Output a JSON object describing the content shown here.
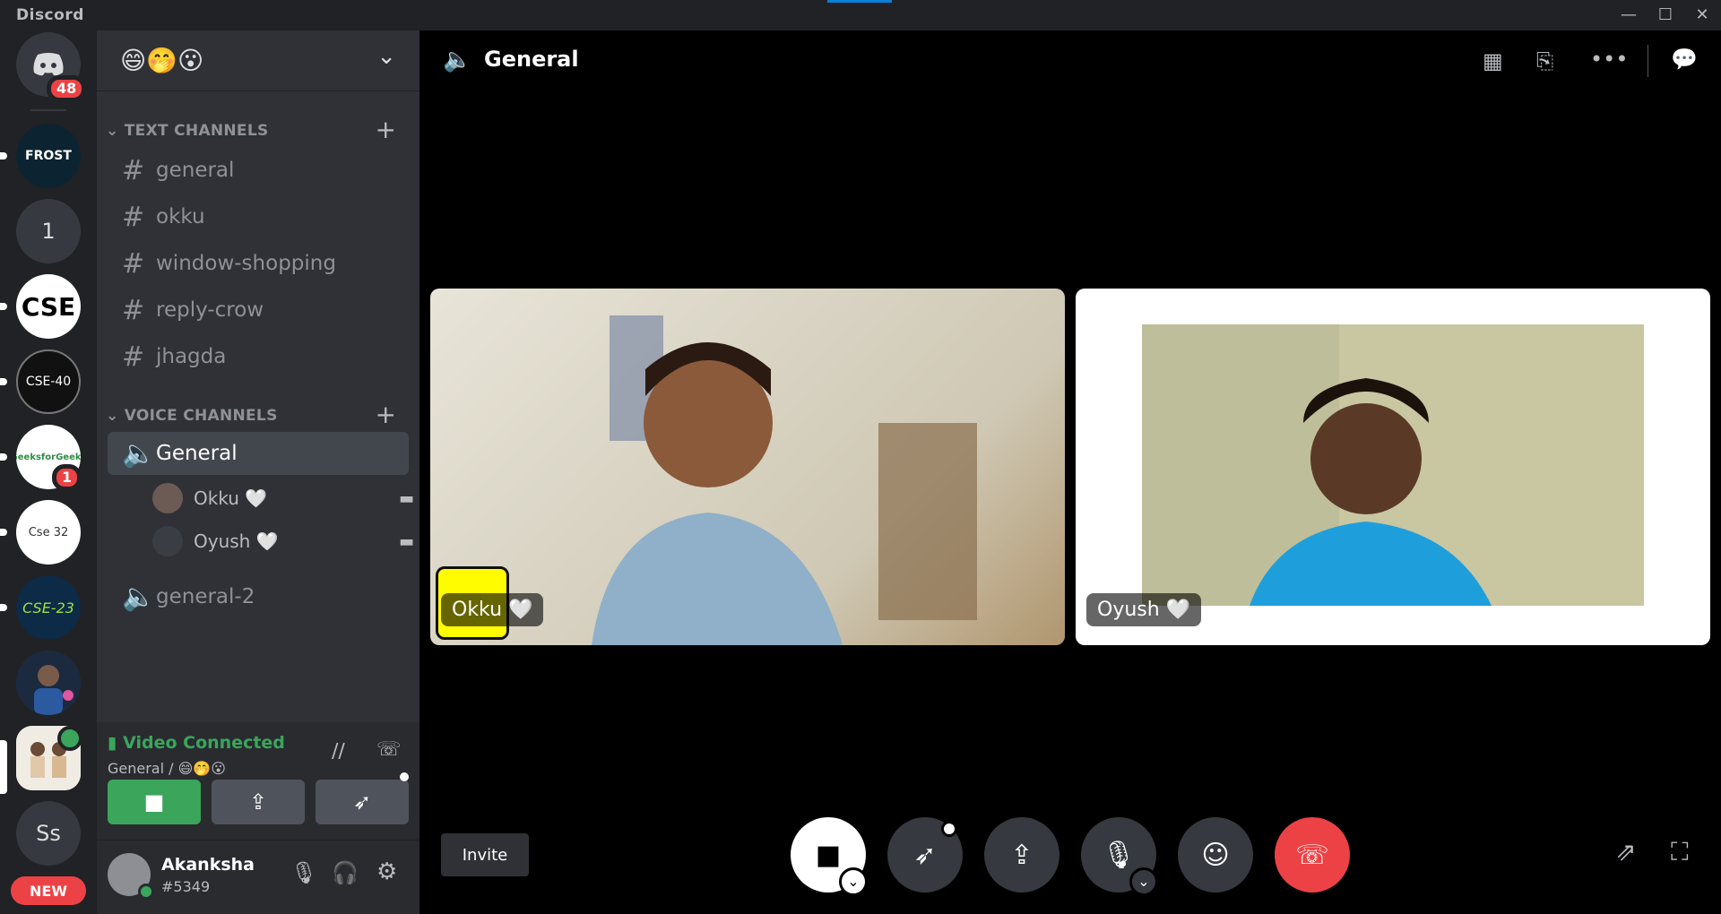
{
  "window": {
    "title": "Discord",
    "controls": [
      "—",
      "☐",
      "✕"
    ]
  },
  "servers": {
    "home_badge": "48",
    "items": [
      {
        "label": "FROST"
      },
      {
        "label": "1"
      },
      {
        "label": "CSE"
      },
      {
        "label": "CSE-40"
      },
      {
        "label": "GeeksforGeeks",
        "badge": "1"
      },
      {
        "label": "Cse 32"
      },
      {
        "label": "CSE-23"
      },
      {
        "label": ""
      },
      {
        "label": ""
      },
      {
        "label": "Ss"
      }
    ],
    "new_label": "NEW"
  },
  "guild": {
    "name": "😄🤭😮",
    "chevron": "⌄"
  },
  "text_channels": {
    "category": "TEXT CHANNELS",
    "items": [
      {
        "name": "general"
      },
      {
        "name": "okku"
      },
      {
        "name": "window-shopping"
      },
      {
        "name": "reply-crow"
      },
      {
        "name": "jhagda"
      }
    ]
  },
  "voice_channels": {
    "category": "VOICE CHANNELS",
    "items": [
      {
        "name": "General"
      },
      {
        "name": "general-2"
      }
    ],
    "members": [
      {
        "name": "Okku 🤍"
      },
      {
        "name": "Oyush 🤍"
      }
    ]
  },
  "voice_panel": {
    "status": "Video Connected",
    "location": "General / 😄🤭😮"
  },
  "user": {
    "name": "Akanksha",
    "tag": "#5349"
  },
  "main": {
    "channel_title": "General",
    "tiles": [
      {
        "name": "Okku 🤍"
      },
      {
        "name": "Oyush 🤍"
      }
    ],
    "invite_label": "Invite"
  },
  "colors": {
    "green": "#3ba55c",
    "red": "#ed4245",
    "accent": "#5865f2",
    "bg_dark": "#202225"
  }
}
